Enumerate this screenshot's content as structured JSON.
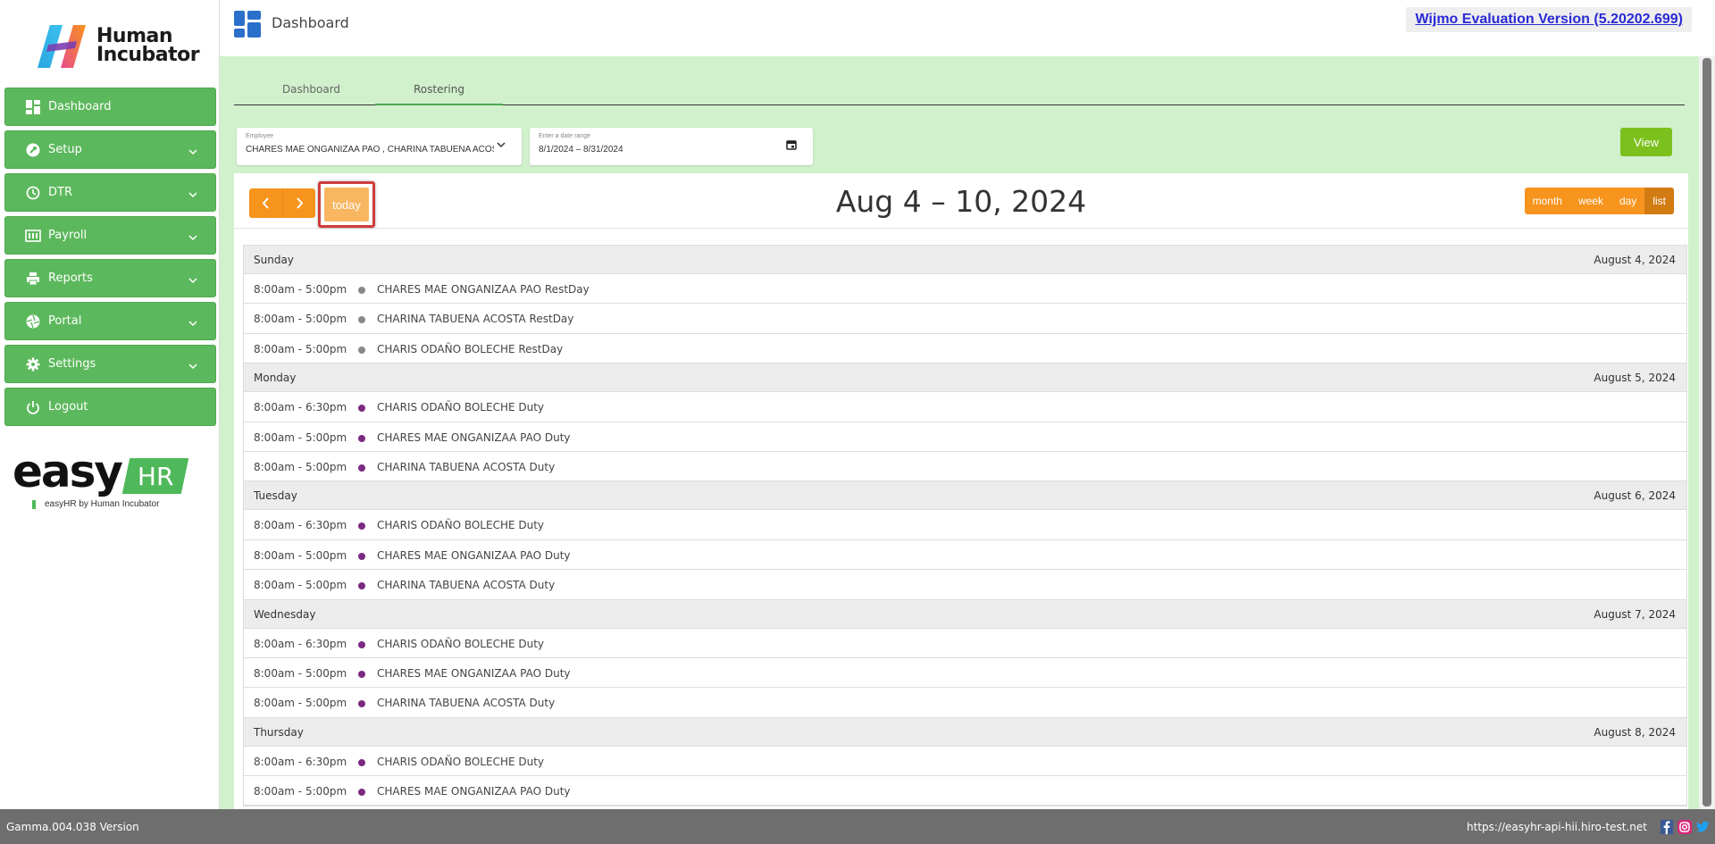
{
  "brand": {
    "name_line1": "Human",
    "name_line2": "Incubator",
    "easy_word": "easy",
    "hr_word": "HR",
    "byline": "easyHR by Human Incubator",
    "colors": {
      "green": "#5cb85c",
      "orange": "#f7941d",
      "purple": "#7b2a82",
      "gray_dot": "#888888"
    }
  },
  "sidebar": {
    "items": [
      {
        "label": "Dashboard",
        "icon": "dashboard-icon",
        "has_chevron": false
      },
      {
        "label": "Setup",
        "icon": "wrench-icon",
        "has_chevron": true
      },
      {
        "label": "DTR",
        "icon": "clock-icon",
        "has_chevron": true
      },
      {
        "label": "Payroll",
        "icon": "money-icon",
        "has_chevron": true
      },
      {
        "label": "Reports",
        "icon": "printer-icon",
        "has_chevron": true
      },
      {
        "label": "Portal",
        "icon": "aperture-icon",
        "has_chevron": true
      },
      {
        "label": "Settings",
        "icon": "gear-icon",
        "has_chevron": true
      },
      {
        "label": "Logout",
        "icon": "power-icon",
        "has_chevron": false
      }
    ]
  },
  "header": {
    "title": "Dashboard",
    "wijmo_notice": "Wijmo Evaluation Version (5.20202.699)"
  },
  "tabs": [
    {
      "label": "Dashboard",
      "active": false
    },
    {
      "label": "Rostering",
      "active": true
    }
  ],
  "filters": {
    "employee_label": "Employee",
    "employee_value": "CHARES MAE ONGANIZAA PAO , CHARINA TABUENA ACOSTA",
    "date_label": "Enter a date range",
    "date_value": "8/1/2024 – 8/31/2024",
    "view_button": "View"
  },
  "calendar": {
    "title": "Aug 4 – 10, 2024",
    "today_label": "today",
    "views": [
      "month",
      "week",
      "day",
      "list"
    ],
    "active_view": "list",
    "days": [
      {
        "name": "Sunday",
        "date": "August 4, 2024",
        "events": [
          {
            "time": "8:00am - 5:00pm",
            "title": "CHARES MAE ONGANIZAA PAO RestDay",
            "type": "rest"
          },
          {
            "time": "8:00am - 5:00pm",
            "title": "CHARINA TABUENA ACOSTA RestDay",
            "type": "rest"
          },
          {
            "time": "8:00am - 5:00pm",
            "title": "CHARIS ODAÑO BOLECHE RestDay",
            "type": "rest"
          }
        ]
      },
      {
        "name": "Monday",
        "date": "August 5, 2024",
        "events": [
          {
            "time": "8:00am - 6:30pm",
            "title": "CHARIS ODAÑO BOLECHE Duty",
            "type": "duty"
          },
          {
            "time": "8:00am - 5:00pm",
            "title": "CHARES MAE ONGANIZAA PAO Duty",
            "type": "duty"
          },
          {
            "time": "8:00am - 5:00pm",
            "title": "CHARINA TABUENA ACOSTA Duty",
            "type": "duty"
          }
        ]
      },
      {
        "name": "Tuesday",
        "date": "August 6, 2024",
        "events": [
          {
            "time": "8:00am - 6:30pm",
            "title": "CHARIS ODAÑO BOLECHE Duty",
            "type": "duty"
          },
          {
            "time": "8:00am - 5:00pm",
            "title": "CHARES MAE ONGANIZAA PAO Duty",
            "type": "duty"
          },
          {
            "time": "8:00am - 5:00pm",
            "title": "CHARINA TABUENA ACOSTA Duty",
            "type": "duty"
          }
        ]
      },
      {
        "name": "Wednesday",
        "date": "August 7, 2024",
        "events": [
          {
            "time": "8:00am - 6:30pm",
            "title": "CHARIS ODAÑO BOLECHE Duty",
            "type": "duty"
          },
          {
            "time": "8:00am - 5:00pm",
            "title": "CHARES MAE ONGANIZAA PAO Duty",
            "type": "duty"
          },
          {
            "time": "8:00am - 5:00pm",
            "title": "CHARINA TABUENA ACOSTA Duty",
            "type": "duty"
          }
        ]
      },
      {
        "name": "Thursday",
        "date": "August 8, 2024",
        "events": [
          {
            "time": "8:00am - 6:30pm",
            "title": "CHARIS ODAÑO BOLECHE Duty",
            "type": "duty"
          },
          {
            "time": "8:00am - 5:00pm",
            "title": "CHARES MAE ONGANIZAA PAO Duty",
            "type": "duty"
          }
        ]
      }
    ]
  },
  "footer": {
    "version": "Gamma.004.038 Version",
    "url": "https://easyhr-api-hii.hiro-test.net",
    "social": [
      "facebook-icon",
      "instagram-icon",
      "twitter-icon"
    ]
  }
}
